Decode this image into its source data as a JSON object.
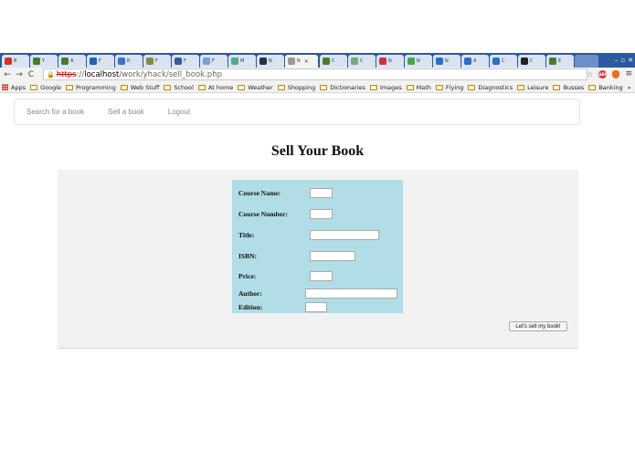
{
  "browser": {
    "tabs": [
      {
        "label": "8",
        "icon": "gmail-icon",
        "color": "#d93025"
      },
      {
        "label": "Y",
        "icon": "puzzle-icon",
        "color": "#4a7b2a"
      },
      {
        "label": "A",
        "icon": "puzzle-icon",
        "color": "#4a7b2a"
      },
      {
        "label": "F",
        "icon": "shield-icon",
        "color": "#1f5fb4"
      },
      {
        "label": "R",
        "icon": "site-icon",
        "color": "#3b6fd1"
      },
      {
        "label": "F",
        "icon": "image-icon",
        "color": "#884"
      },
      {
        "label": "F",
        "icon": "facebook-icon",
        "color": "#3b5998"
      },
      {
        "label": "F",
        "icon": "link-icon",
        "color": "#7aa0d0"
      },
      {
        "label": "M",
        "icon": "site-icon",
        "color": "#5a8"
      },
      {
        "label": "N",
        "icon": "site-icon",
        "color": "#234"
      },
      {
        "label": "N",
        "icon": "page-icon",
        "color": "#999"
      },
      {
        "label": "C",
        "icon": "puzzle-icon",
        "color": "#4a7b2a"
      },
      {
        "label": "C",
        "icon": "site-icon",
        "color": "#7a7"
      },
      {
        "label": "N",
        "icon": "flag-icon",
        "color": "#c33"
      },
      {
        "label": "N",
        "icon": "site-icon",
        "color": "#4a4"
      },
      {
        "label": "N",
        "icon": "site-icon",
        "color": "#2a6fc9"
      },
      {
        "label": "A",
        "icon": "site-icon",
        "color": "#2a6fc9"
      },
      {
        "label": "C",
        "icon": "google-icon",
        "color": "#2a6fc9"
      },
      {
        "label": "C",
        "icon": "github-icon",
        "color": "#222"
      },
      {
        "label": "E",
        "icon": "puzzle-icon",
        "color": "#4a7b2a"
      }
    ],
    "active_tab_label": "N",
    "url": {
      "scheme": "https",
      "sep": "://",
      "host": "localhost",
      "path": "/work/yhack/sell_book.php"
    },
    "bookmarks": [
      "Google",
      "Programming",
      "Web Stuff",
      "School",
      "At home",
      "Weather",
      "Shopping",
      "Dictionaries",
      "Images",
      "Math",
      "Flying",
      "Diagnostics",
      "Leisure",
      "Busses",
      "Banking"
    ],
    "apps_label": "Apps",
    "more_label": "»"
  },
  "nav": {
    "search": "Search for a book",
    "sell": "Sell a book",
    "logout": "Logout"
  },
  "page": {
    "title": "Sell Your Book"
  },
  "form": {
    "course_name": {
      "label": "Course Name:",
      "value": ""
    },
    "course_number": {
      "label": "Course Number:",
      "value": ""
    },
    "title": {
      "label": "Title:",
      "value": ""
    },
    "isbn": {
      "label": "ISBN:",
      "value": ""
    },
    "price": {
      "label": "Price:",
      "value": ""
    },
    "author": {
      "label": "Author:",
      "value": ""
    },
    "edition": {
      "label": "Edition:",
      "value": ""
    },
    "submit_label": "Let's sell my book!"
  },
  "colors": {
    "tabstrip": "#2c5aa0",
    "form_bg": "#b0dde6",
    "panel_bg": "#f2f2f2"
  }
}
